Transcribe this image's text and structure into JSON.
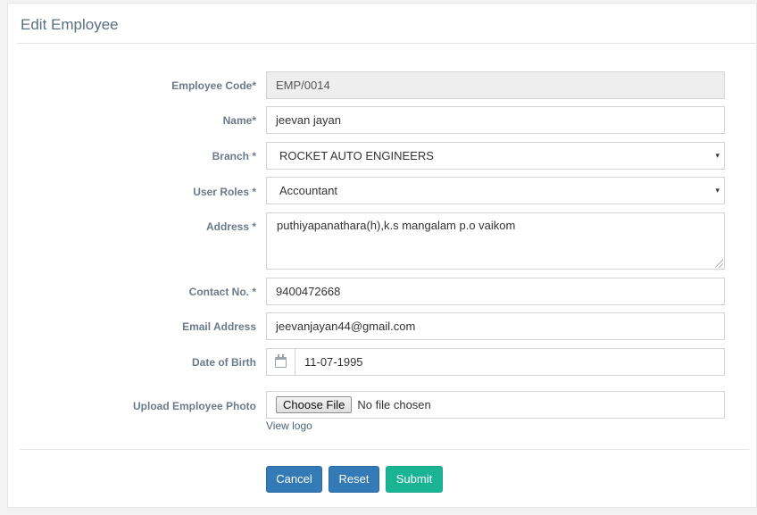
{
  "panel": {
    "title": "Edit Employee"
  },
  "form": {
    "employee_code": {
      "label": "Employee Code*",
      "value": "EMP/0014"
    },
    "name": {
      "label": "Name*",
      "value": "jeevan jayan"
    },
    "branch": {
      "label": "Branch *",
      "value": "ROCKET AUTO ENGINEERS"
    },
    "user_roles": {
      "label": "User Roles *",
      "value": "Accountant"
    },
    "address": {
      "label": "Address *",
      "value": "puthiyapanathara(h),k.s mangalam p.o vaikom"
    },
    "contact": {
      "label": "Contact No. *",
      "value": "9400472668"
    },
    "email": {
      "label": "Email Address",
      "value": "jeevanjayan44@gmail.com"
    },
    "dob": {
      "label": "Date of Birth",
      "value": "11-07-1995",
      "icon": "calendar-icon"
    },
    "photo": {
      "label": "Upload Employee Photo",
      "button": "Choose File",
      "status": "No file chosen",
      "link": "View logo"
    }
  },
  "dropdown_icon": "▾",
  "buttons": {
    "cancel": "Cancel",
    "reset": "Reset",
    "submit": "Submit"
  },
  "colors": {
    "primary": "#337ab7",
    "success": "#1ab394",
    "label": "#6b7a89"
  }
}
